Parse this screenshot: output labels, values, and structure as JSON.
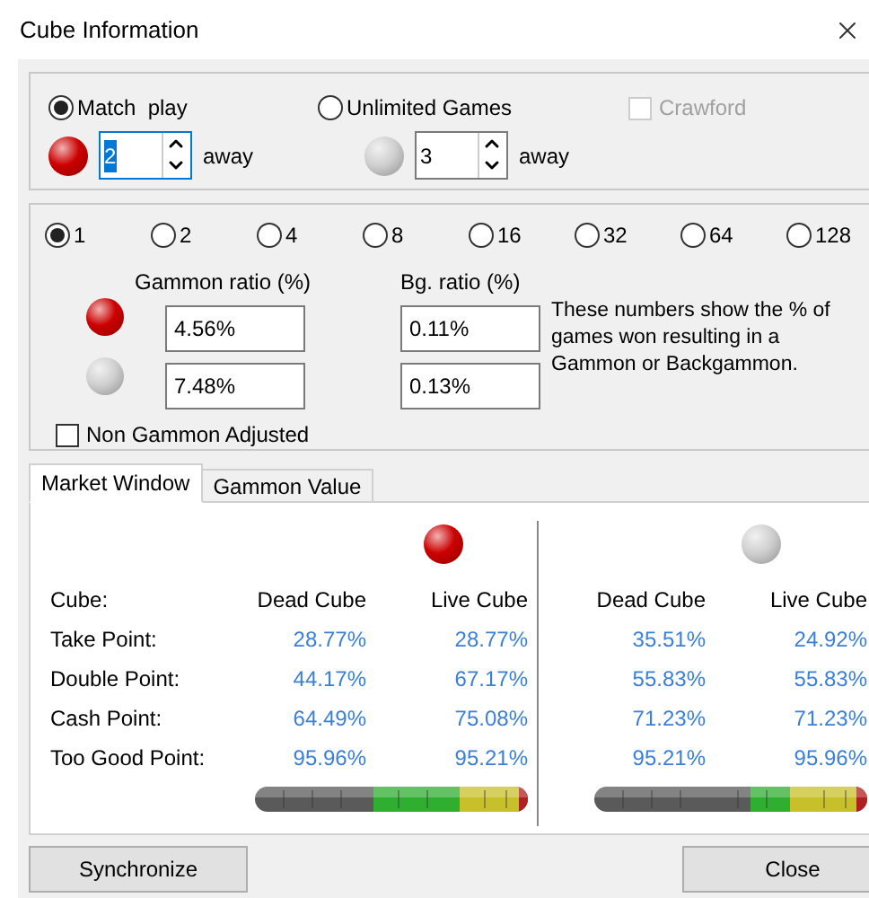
{
  "window": {
    "title": "Cube Information"
  },
  "mode": {
    "options": [
      {
        "label": "Match  play",
        "selected": true
      },
      {
        "label": "Unlimited Games",
        "selected": false
      }
    ],
    "crawford": {
      "label": "Crawford",
      "checked": false,
      "disabled": true
    }
  },
  "players": [
    {
      "color": "#cc0000",
      "away": "2",
      "away_label": "away",
      "focused": true
    },
    {
      "color": "#d0d0d0",
      "away": "3",
      "away_label": "away",
      "focused": false
    }
  ],
  "cube_values": [
    {
      "label": "1",
      "selected": true
    },
    {
      "label": "2",
      "selected": false
    },
    {
      "label": "4",
      "selected": false
    },
    {
      "label": "8",
      "selected": false
    },
    {
      "label": "16",
      "selected": false
    },
    {
      "label": "32",
      "selected": false
    },
    {
      "label": "64",
      "selected": false
    },
    {
      "label": "128",
      "selected": false
    }
  ],
  "ratios": {
    "gammon_heading": "Gammon ratio (%)",
    "bg_heading": "Bg. ratio (%)",
    "rows": [
      {
        "gammon": "4.56%",
        "bg": "0.11%"
      },
      {
        "gammon": "7.48%",
        "bg": "0.13%"
      }
    ],
    "note": "These numbers show the % of games won resulting in a Gammon or Backgammon.",
    "non_gammon_adjusted": {
      "label": "Non Gammon Adjusted",
      "checked": false
    }
  },
  "tabs": [
    {
      "label": "Market Window",
      "selected": true
    },
    {
      "label": "Gammon Value",
      "selected": false
    }
  ],
  "market": {
    "row_labels": [
      "Cube:",
      "Take Point:",
      "Double Point:",
      "Cash Point:",
      "Too Good Point:"
    ],
    "sides": [
      {
        "headers": [
          "Dead Cube",
          "Live Cube"
        ],
        "rows": [
          [
            "28.77%",
            "28.77%"
          ],
          [
            "44.17%",
            "67.17%"
          ],
          [
            "64.49%",
            "75.08%"
          ],
          [
            "95.96%",
            "95.21%"
          ]
        ]
      },
      {
        "headers": [
          "Dead Cube",
          "Live Cube"
        ],
        "rows": [
          [
            "35.51%",
            "24.92%"
          ],
          [
            "55.83%",
            "55.83%"
          ],
          [
            "71.23%",
            "71.23%"
          ],
          [
            "95.21%",
            "95.96%"
          ]
        ]
      }
    ]
  },
  "buttons": [
    "Synchronize",
    "Close"
  ]
}
